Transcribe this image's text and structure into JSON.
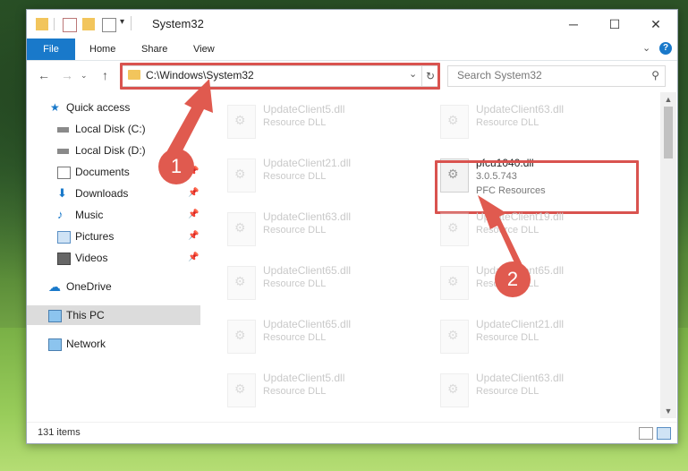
{
  "window": {
    "title": "System32",
    "controls": [
      "─",
      "☐",
      "✕"
    ]
  },
  "ribbon": {
    "tabs": [
      "File",
      "Home",
      "Share",
      "View"
    ]
  },
  "address": {
    "path": "C:\\Windows\\System32",
    "search_placeholder": "Search System32"
  },
  "navigation": {
    "items": [
      {
        "label": "Quick access",
        "icon": "star-icon"
      },
      {
        "label": "Local Disk (C:)",
        "icon": "drive-icon"
      },
      {
        "label": "Local Disk (D:)",
        "icon": "drive-icon"
      },
      {
        "label": "Documents",
        "icon": "documents-icon",
        "pinned": true
      },
      {
        "label": "Downloads",
        "icon": "downloads-icon",
        "pinned": true
      },
      {
        "label": "Music",
        "icon": "music-icon",
        "pinned": true
      },
      {
        "label": "Pictures",
        "icon": "pictures-icon",
        "pinned": true
      },
      {
        "label": "Videos",
        "icon": "videos-icon",
        "pinned": true
      },
      {
        "label": "OneDrive",
        "icon": "cloud-icon"
      },
      {
        "label": "This PC",
        "icon": "pc-icon",
        "selected": true
      },
      {
        "label": "Network",
        "icon": "network-icon"
      }
    ]
  },
  "files": [
    {
      "name": "UpdateClient5.dll",
      "desc": "Resource DLL"
    },
    {
      "name": "UpdateClient63.dll",
      "desc": "Resource DLL"
    },
    {
      "name": "UpdateClient21.dll",
      "desc": "Resource DLL"
    },
    {
      "name": "pfcu1040.dll",
      "desc": "3.0.5.743",
      "desc2": "PFC Resources",
      "highlighted": true
    },
    {
      "name": "UpdateClient63.dll",
      "desc": "Resource DLL"
    },
    {
      "name": "UpdateClient19.dll",
      "desc": "Resource DLL"
    },
    {
      "name": "UpdateClient65.dll",
      "desc": "Resource DLL"
    },
    {
      "name": "UpdateClient65.dll",
      "desc": "Resource DLL"
    },
    {
      "name": "UpdateClient65.dll",
      "desc": "Resource DLL"
    },
    {
      "name": "UpdateClient21.dll",
      "desc": "Resource DLL"
    },
    {
      "name": "UpdateClient5.dll",
      "desc": "Resource DLL"
    },
    {
      "name": "UpdateClient63.dll",
      "desc": "Resource DLL"
    }
  ],
  "status": {
    "item_count": "131 items"
  },
  "annotations": {
    "step1": "1",
    "step2": "2"
  },
  "colors": {
    "accent": "#1979ca",
    "highlight": "#d9534f",
    "annotation": "#e05a4f"
  }
}
